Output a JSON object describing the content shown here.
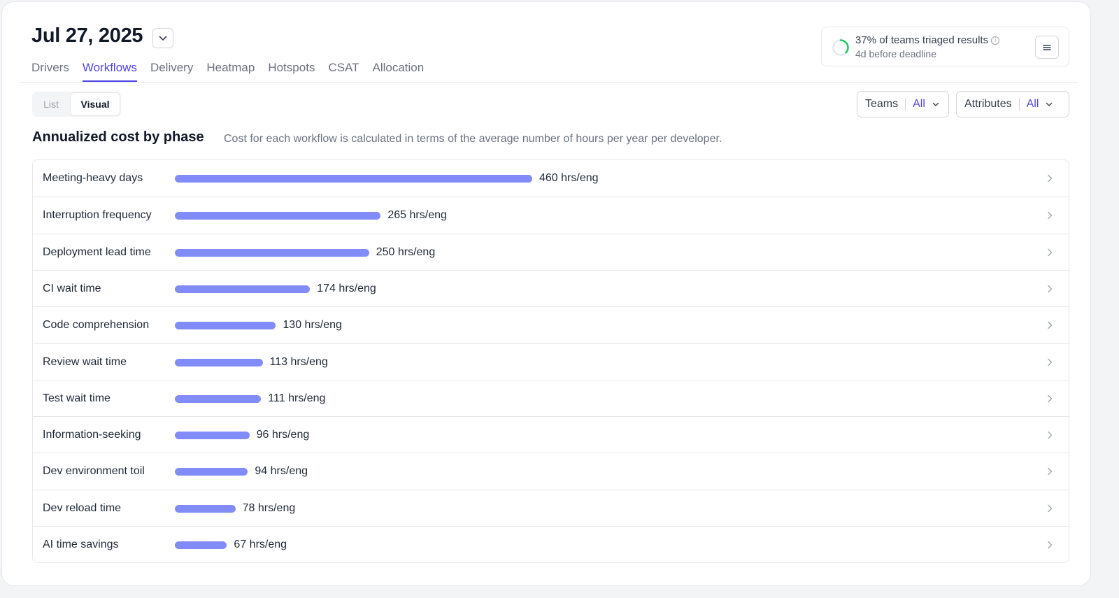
{
  "header": {
    "date": "Jul 27, 2025",
    "date_dropdown_icon": "chevron-down-icon"
  },
  "tabs": [
    {
      "label": "Drivers",
      "active": false
    },
    {
      "label": "Workflows",
      "active": true
    },
    {
      "label": "Delivery",
      "active": false
    },
    {
      "label": "Heatmap",
      "active": false
    },
    {
      "label": "Hotspots",
      "active": false
    },
    {
      "label": "CSAT",
      "active": false
    },
    {
      "label": "Allocation",
      "active": false
    }
  ],
  "triage": {
    "progress_percent": 37,
    "text": "37% of teams triaged results",
    "info_icon": "info-icon",
    "subtext": "4d before deadline",
    "menu_icon": "menu-icon"
  },
  "view_toggle": {
    "list_label": "List",
    "visual_label": "Visual",
    "selected": "Visual"
  },
  "filters": {
    "teams": {
      "label": "Teams",
      "value": "All"
    },
    "attributes": {
      "label": "Attributes",
      "value": "All"
    }
  },
  "section": {
    "title": "Annualized cost by phase",
    "description": "Cost for each workflow is calculated in terms of the average number of hours per year per developer."
  },
  "colors": {
    "accent": "#4f46e5",
    "bar": "#818cf8",
    "progress": "#22c55e"
  },
  "chart_data": {
    "type": "bar",
    "unit": "hrs/eng",
    "categories": [
      "Meeting-heavy days",
      "Interruption frequency",
      "Deployment lead time",
      "CI wait time",
      "Code comprehension",
      "Review wait time",
      "Test wait time",
      "Information-seeking",
      "Dev environment toil",
      "Dev reload time",
      "AI time savings"
    ],
    "values": [
      460,
      265,
      250,
      174,
      130,
      113,
      111,
      96,
      94,
      78,
      67
    ],
    "value_labels": [
      "460 hrs/eng",
      "265 hrs/eng",
      "250 hrs/eng",
      "174 hrs/eng",
      "130 hrs/eng",
      "113 hrs/eng",
      "111 hrs/eng",
      "96 hrs/eng",
      "94 hrs/eng",
      "78 hrs/eng",
      "67 hrs/eng"
    ]
  }
}
